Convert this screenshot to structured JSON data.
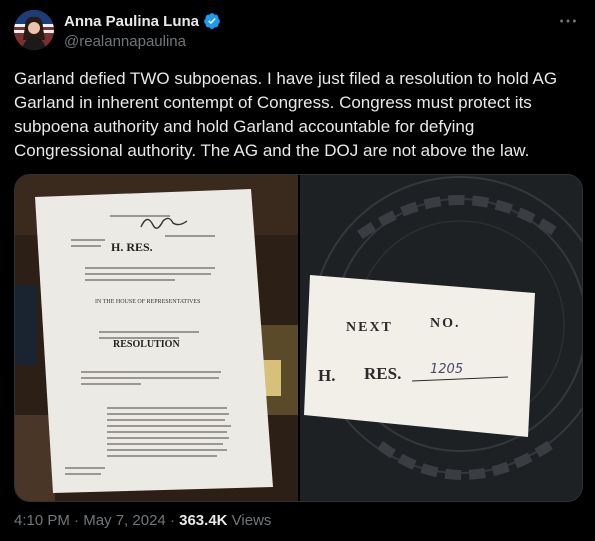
{
  "user": {
    "display_name": "Anna Paulina Luna",
    "handle": "@realannapaulina",
    "avatar_icon": "profile-photo"
  },
  "tweet": {
    "text": "Garland defied TWO subpoenas. I have just filed a resolution to hold AG Garland in inherent contempt of Congress. Congress must protect its subpoena authority and hold Garland accountable for defying Congressional authority. The AG and the DOJ are not above the law."
  },
  "media": {
    "left_doc": {
      "h_res": "H. RES.",
      "house_line": "IN THE HOUSE OF REPRESENTATIVES",
      "heading": "RESOLUTION"
    },
    "right_card": {
      "line1_next": "NEXT",
      "line1_no": "NO.",
      "line2_h": "H.",
      "line2_res": "RES.",
      "number": "1205"
    }
  },
  "meta": {
    "time": "4:10 PM",
    "separator": "·",
    "date": "May 7, 2024",
    "views_count": "363.4K",
    "views_label": "Views"
  },
  "colors": {
    "background": "#000000",
    "text": "#e7e9ea",
    "secondary": "#71767b",
    "verified": "#1d9bf0"
  }
}
